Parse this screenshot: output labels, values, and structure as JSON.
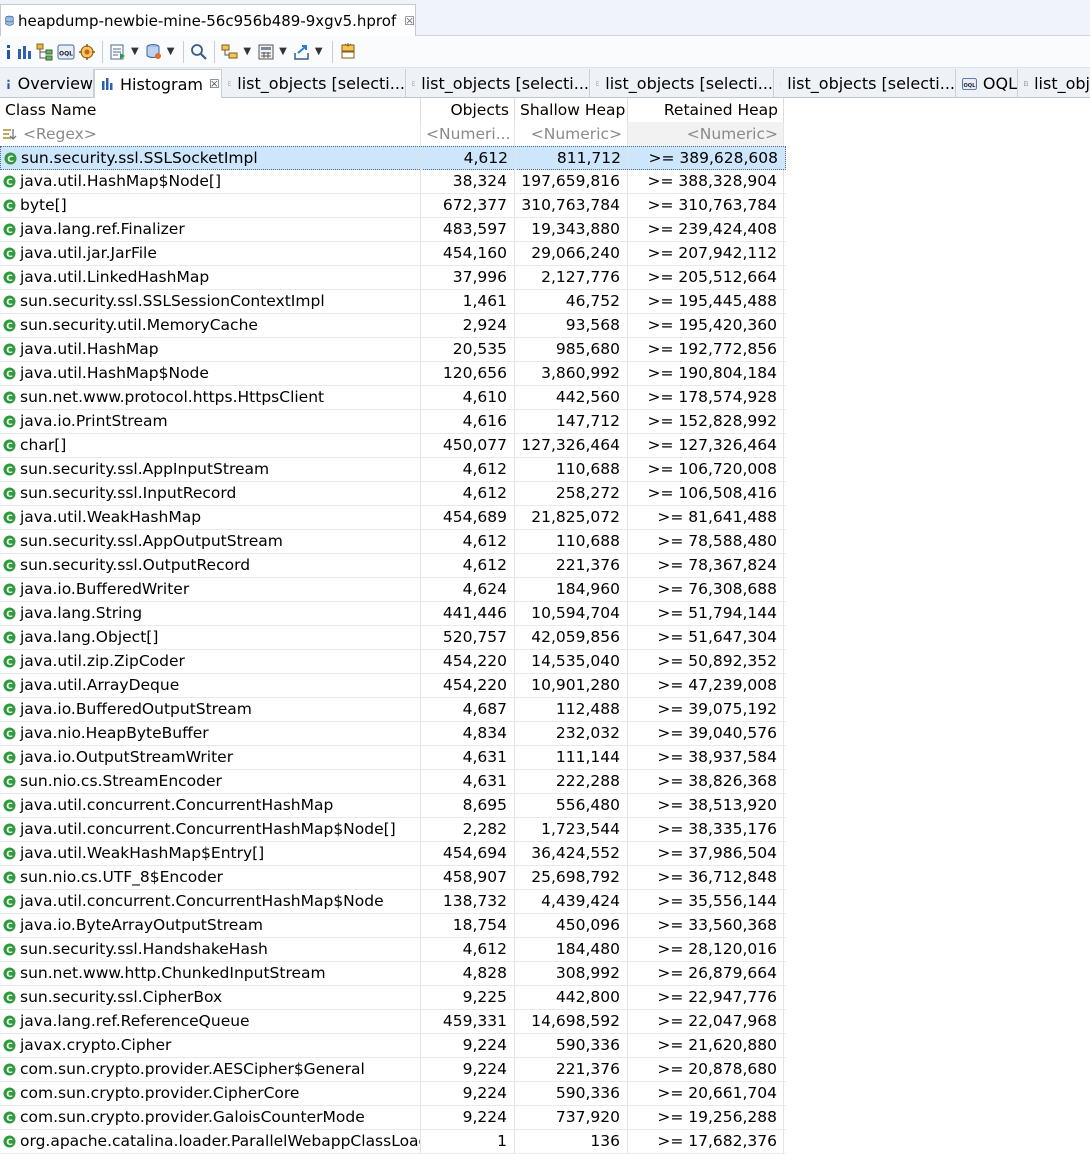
{
  "editor": {
    "title": "heapdump-newbie-mine-56c956b489-9xgv5.hprof",
    "close_glyph": "☒"
  },
  "toolbar": {
    "icons": [
      "info-icon",
      "histogram-icon",
      "dominator-tree-icon",
      "oql-icon",
      "thread-overview-icon",
      "run-report-icon",
      "query-browser-icon",
      "search-icon",
      "group-by-icon",
      "calculate-retained-icon",
      "export-icon",
      "pin-icon"
    ]
  },
  "view_tabs": [
    {
      "icon": "i",
      "label": "Overview",
      "active": false
    },
    {
      "icon": "histogram",
      "label": "Histogram",
      "active": true,
      "close": "☒"
    },
    {
      "icon": "list",
      "label": "list_objects [selecti...",
      "active": false
    },
    {
      "icon": "list",
      "label": "list_objects [selecti...",
      "active": false
    },
    {
      "icon": "list",
      "label": "list_objects [selecti...",
      "active": false
    },
    {
      "icon": "list",
      "label": "list_objects [selecti...",
      "active": false
    },
    {
      "icon": "oql",
      "label": "OQL",
      "active": false
    },
    {
      "icon": "list",
      "label": "list_obj",
      "active": false
    }
  ],
  "columns": {
    "class_name": "Class Name",
    "objects": "Objects",
    "shallow_heap": "Shallow Heap",
    "retained_heap": "Retained Heap"
  },
  "filters": {
    "class_name": "<Regex>",
    "objects": "<Numeri...",
    "shallow_heap": "<Numeric>",
    "retained_heap": "<Numeric>"
  },
  "colors": {
    "class_icon": "#2f9a3c",
    "selected_row": "#cde6fb"
  },
  "rows": [
    {
      "name": "sun.security.ssl.SSLSocketImpl",
      "objects": "4,612",
      "shallow": "811,712",
      "retained": ">= 389,628,608",
      "selected": true
    },
    {
      "name": "java.util.HashMap$Node[]",
      "objects": "38,324",
      "shallow": "197,659,816",
      "retained": ">= 388,328,904"
    },
    {
      "name": "byte[]",
      "objects": "672,377",
      "shallow": "310,763,784",
      "retained": ">= 310,763,784"
    },
    {
      "name": "java.lang.ref.Finalizer",
      "objects": "483,597",
      "shallow": "19,343,880",
      "retained": ">= 239,424,408"
    },
    {
      "name": "java.util.jar.JarFile",
      "objects": "454,160",
      "shallow": "29,066,240",
      "retained": ">= 207,942,112"
    },
    {
      "name": "java.util.LinkedHashMap",
      "objects": "37,996",
      "shallow": "2,127,776",
      "retained": ">= 205,512,664"
    },
    {
      "name": "sun.security.ssl.SSLSessionContextImpl",
      "objects": "1,461",
      "shallow": "46,752",
      "retained": ">= 195,445,488"
    },
    {
      "name": "sun.security.util.MemoryCache",
      "objects": "2,924",
      "shallow": "93,568",
      "retained": ">= 195,420,360"
    },
    {
      "name": "java.util.HashMap",
      "objects": "20,535",
      "shallow": "985,680",
      "retained": ">= 192,772,856"
    },
    {
      "name": "java.util.HashMap$Node",
      "objects": "120,656",
      "shallow": "3,860,992",
      "retained": ">= 190,804,184"
    },
    {
      "name": "sun.net.www.protocol.https.HttpsClient",
      "objects": "4,610",
      "shallow": "442,560",
      "retained": ">= 178,574,928"
    },
    {
      "name": "java.io.PrintStream",
      "objects": "4,616",
      "shallow": "147,712",
      "retained": ">= 152,828,992"
    },
    {
      "name": "char[]",
      "objects": "450,077",
      "shallow": "127,326,464",
      "retained": ">= 127,326,464"
    },
    {
      "name": "sun.security.ssl.AppInputStream",
      "objects": "4,612",
      "shallow": "110,688",
      "retained": ">= 106,720,008"
    },
    {
      "name": "sun.security.ssl.InputRecord",
      "objects": "4,612",
      "shallow": "258,272",
      "retained": ">= 106,508,416"
    },
    {
      "name": "java.util.WeakHashMap",
      "objects": "454,689",
      "shallow": "21,825,072",
      "retained": ">= 81,641,488"
    },
    {
      "name": "sun.security.ssl.AppOutputStream",
      "objects": "4,612",
      "shallow": "110,688",
      "retained": ">= 78,588,480"
    },
    {
      "name": "sun.security.ssl.OutputRecord",
      "objects": "4,612",
      "shallow": "221,376",
      "retained": ">= 78,367,824"
    },
    {
      "name": "java.io.BufferedWriter",
      "objects": "4,624",
      "shallow": "184,960",
      "retained": ">= 76,308,688"
    },
    {
      "name": "java.lang.String",
      "objects": "441,446",
      "shallow": "10,594,704",
      "retained": ">= 51,794,144"
    },
    {
      "name": "java.lang.Object[]",
      "objects": "520,757",
      "shallow": "42,059,856",
      "retained": ">= 51,647,304"
    },
    {
      "name": "java.util.zip.ZipCoder",
      "objects": "454,220",
      "shallow": "14,535,040",
      "retained": ">= 50,892,352"
    },
    {
      "name": "java.util.ArrayDeque",
      "objects": "454,220",
      "shallow": "10,901,280",
      "retained": ">= 47,239,008"
    },
    {
      "name": "java.io.BufferedOutputStream",
      "objects": "4,687",
      "shallow": "112,488",
      "retained": ">= 39,075,192"
    },
    {
      "name": "java.nio.HeapByteBuffer",
      "objects": "4,834",
      "shallow": "232,032",
      "retained": ">= 39,040,576"
    },
    {
      "name": "java.io.OutputStreamWriter",
      "objects": "4,631",
      "shallow": "111,144",
      "retained": ">= 38,937,584"
    },
    {
      "name": "sun.nio.cs.StreamEncoder",
      "objects": "4,631",
      "shallow": "222,288",
      "retained": ">= 38,826,368"
    },
    {
      "name": "java.util.concurrent.ConcurrentHashMap",
      "objects": "8,695",
      "shallow": "556,480",
      "retained": ">= 38,513,920"
    },
    {
      "name": "java.util.concurrent.ConcurrentHashMap$Node[]",
      "objects": "2,282",
      "shallow": "1,723,544",
      "retained": ">= 38,335,176"
    },
    {
      "name": "java.util.WeakHashMap$Entry[]",
      "objects": "454,694",
      "shallow": "36,424,552",
      "retained": ">= 37,986,504"
    },
    {
      "name": "sun.nio.cs.UTF_8$Encoder",
      "objects": "458,907",
      "shallow": "25,698,792",
      "retained": ">= 36,712,848"
    },
    {
      "name": "java.util.concurrent.ConcurrentHashMap$Node",
      "objects": "138,732",
      "shallow": "4,439,424",
      "retained": ">= 35,556,144"
    },
    {
      "name": "java.io.ByteArrayOutputStream",
      "objects": "18,754",
      "shallow": "450,096",
      "retained": ">= 33,560,368"
    },
    {
      "name": "sun.security.ssl.HandshakeHash",
      "objects": "4,612",
      "shallow": "184,480",
      "retained": ">= 28,120,016"
    },
    {
      "name": "sun.net.www.http.ChunkedInputStream",
      "objects": "4,828",
      "shallow": "308,992",
      "retained": ">= 26,879,664"
    },
    {
      "name": "sun.security.ssl.CipherBox",
      "objects": "9,225",
      "shallow": "442,800",
      "retained": ">= 22,947,776"
    },
    {
      "name": "java.lang.ref.ReferenceQueue",
      "objects": "459,331",
      "shallow": "14,698,592",
      "retained": ">= 22,047,968"
    },
    {
      "name": "javax.crypto.Cipher",
      "objects": "9,224",
      "shallow": "590,336",
      "retained": ">= 21,620,880"
    },
    {
      "name": "com.sun.crypto.provider.AESCipher$General",
      "objects": "9,224",
      "shallow": "221,376",
      "retained": ">= 20,878,680"
    },
    {
      "name": "com.sun.crypto.provider.CipherCore",
      "objects": "9,224",
      "shallow": "590,336",
      "retained": ">= 20,661,704"
    },
    {
      "name": "com.sun.crypto.provider.GaloisCounterMode",
      "objects": "9,224",
      "shallow": "737,920",
      "retained": ">= 19,256,288"
    },
    {
      "name": "org.apache.catalina.loader.ParallelWebappClassLoader",
      "objects": "1",
      "shallow": "136",
      "retained": ">= 17,682,376"
    }
  ]
}
